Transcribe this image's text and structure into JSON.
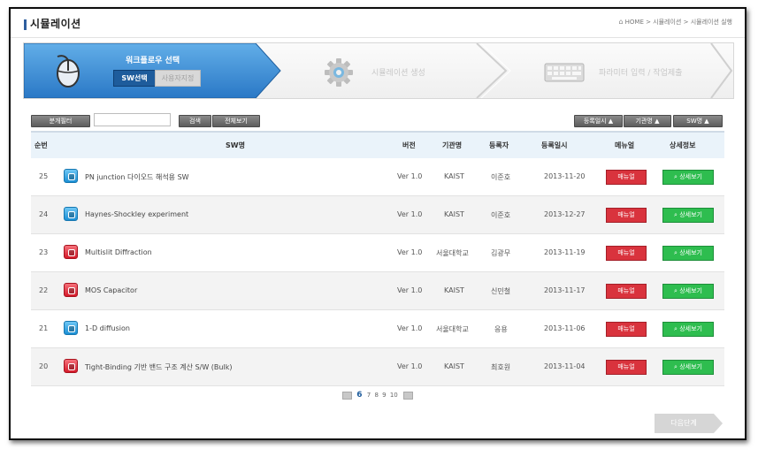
{
  "header": {
    "title": "시뮬레이션",
    "breadcrumb": "HOME > 시뮬레이션 > 시뮬레이션 실행"
  },
  "steps": {
    "step1_label": "워크플로우 선택",
    "sw_select_label": "SW선택",
    "user_spec_label": "사용자지정",
    "step2_label": "시뮬레이션 생성",
    "step3_label": "파라미터 입력 / 작업제출"
  },
  "filter": {
    "category_button": "분개필터",
    "input_value": "",
    "search_button": "검색",
    "show_all_button": "전체보기",
    "sort_date": "등록일시 ▲",
    "sort_org": "기관명 ▲",
    "sort_sw": "SW명 ▲"
  },
  "table": {
    "headers": {
      "num": "순번",
      "sw": "SW명",
      "version": "버전",
      "org": "기관명",
      "author": "등록자",
      "date": "등록일시",
      "manual": "메뉴얼",
      "detail": "상세정보"
    },
    "rows": [
      {
        "num": "25",
        "name": "PN junction 다이오드 해석용 SW",
        "icon": "blue",
        "version": "Ver 1.0",
        "org": "KAIST",
        "author": "이준호",
        "date": "2013-11-20",
        "manual": "매뉴얼",
        "detail": "상세보기"
      },
      {
        "num": "24",
        "name": "Haynes-Shockley experiment",
        "icon": "blue",
        "version": "Ver 1.0",
        "org": "KAIST",
        "author": "이준호",
        "date": "2013-12-27",
        "manual": "매뉴얼",
        "detail": "상세보기"
      },
      {
        "num": "23",
        "name": "Multislit Diffraction",
        "icon": "red",
        "version": "Ver 1.0",
        "org": "서울대학교",
        "author": "김광무",
        "date": "2013-11-19",
        "manual": "매뉴얼",
        "detail": "상세보기"
      },
      {
        "num": "22",
        "name": "MOS Capacitor",
        "icon": "red",
        "version": "Ver 1.0",
        "org": "KAIST",
        "author": "신민철",
        "date": "2013-11-17",
        "manual": "매뉴얼",
        "detail": "상세보기"
      },
      {
        "num": "21",
        "name": "1-D diffusion",
        "icon": "blue",
        "version": "Ver 1.0",
        "org": "서울대학교",
        "author": "응용",
        "date": "2013-11-06",
        "manual": "매뉴얼",
        "detail": "상세보기"
      },
      {
        "num": "20",
        "name": "Tight-Binding 기반 밴드 구조 계산 S/W (Bulk)",
        "icon": "red",
        "version": "Ver 1.0",
        "org": "KAIST",
        "author": "최호원",
        "date": "2013-11-04",
        "manual": "매뉴얼",
        "detail": "상세보기"
      }
    ]
  },
  "pagination": {
    "current": "6",
    "pages": [
      "7",
      "8",
      "9",
      "10"
    ]
  },
  "next_button": "다음단계",
  "colors": {
    "accent": "#1e5c9c",
    "manual": "#d9333d",
    "detail": "#2ebd4f"
  }
}
